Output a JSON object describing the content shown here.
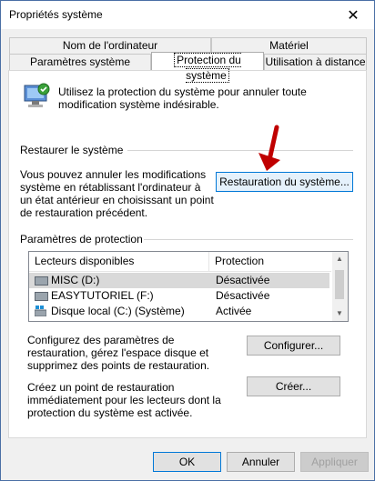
{
  "window": {
    "title": "Propriétés système",
    "close_glyph": "✕"
  },
  "tabs": {
    "row1": [
      "Nom de l'ordinateur",
      "Matériel"
    ],
    "row2": [
      "Paramètres système avancés",
      "Protection du système",
      "Utilisation à distance"
    ],
    "active": "Protection du système"
  },
  "intro": {
    "text": "Utilisez la protection du système pour annuler toute modification système indésirable."
  },
  "restore": {
    "group_label": "Restaurer le système",
    "description": "Vous pouvez annuler les modifications système en rétablissant l'ordinateur à un état antérieur en choisissant un point de restauration précédent.",
    "button": "Restauration du système..."
  },
  "protection": {
    "group_label": "Paramètres de protection",
    "columns": [
      "Lecteurs disponibles",
      "Protection"
    ],
    "drives": [
      {
        "name": "MISC (D:)",
        "status": "Désactivée",
        "icon": "drive-icon"
      },
      {
        "name": "EASYTUTORIEL (F:)",
        "status": "Désactivée",
        "icon": "drive-icon"
      },
      {
        "name": "Disque local (C:) (Système)",
        "status": "Activée",
        "icon": "system-drive-icon"
      }
    ],
    "configure_text": "Configurez des paramètres de restauration, gérez l'espace disque et supprimez des points de restauration.",
    "configure_button": "Configurer...",
    "create_text": "Créez un point de restauration immédiatement pour les lecteurs dont la protection du système est activée.",
    "create_button": "Créer..."
  },
  "footer": {
    "ok": "OK",
    "cancel": "Annuler",
    "apply": "Appliquer"
  },
  "colors": {
    "arrow": "#c00000",
    "focus_border": "#0078d7"
  }
}
